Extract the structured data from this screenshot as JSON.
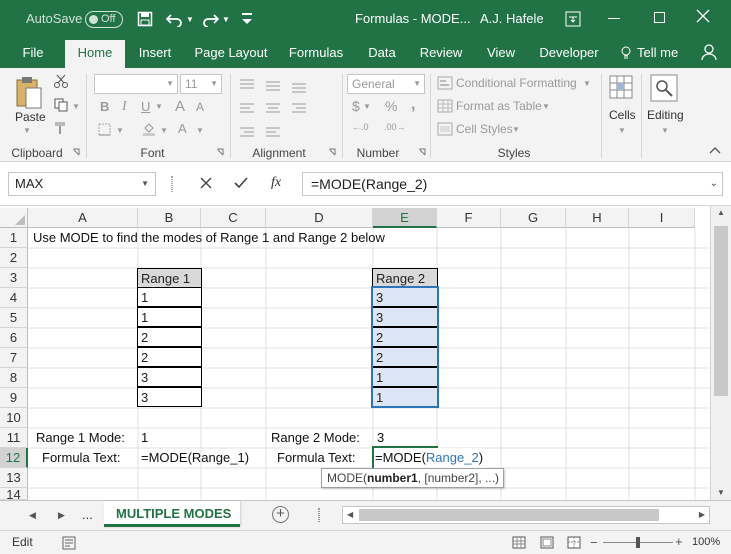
{
  "titlebar": {
    "autosave_label": "AutoSave",
    "autosave_state": "Off",
    "doc_title": "Formulas - MODE...",
    "user": "A.J. Hafele"
  },
  "tabs": [
    "File",
    "Home",
    "Insert",
    "Page Layout",
    "Formulas",
    "Data",
    "Review",
    "View",
    "Developer"
  ],
  "active_tab": "Home",
  "tell_me": "Tell me",
  "ribbon": {
    "paste": "Paste",
    "clipboard": "Clipboard",
    "font": "Font",
    "font_size": "11",
    "alignment": "Alignment",
    "number_format": "General",
    "number": "Number",
    "conditional_formatting": "Conditional Formatting",
    "format_as_table": "Format as Table",
    "cell_styles": "Cell Styles",
    "styles": "Styles",
    "cells": "Cells",
    "editing": "Editing"
  },
  "formula_bar": {
    "name_box": "MAX",
    "formula": "=MODE(Range_2)"
  },
  "columns": [
    "A",
    "B",
    "C",
    "D",
    "E",
    "F",
    "G",
    "H",
    "I"
  ],
  "selected_column": "E",
  "rows": [
    "1",
    "2",
    "3",
    "4",
    "5",
    "6",
    "7",
    "8",
    "9",
    "10",
    "11",
    "12",
    "13",
    "14"
  ],
  "selected_row": "12",
  "sheet": {
    "a1": "Use MODE to find the modes of Range 1 and Range 2 below",
    "range1_header": "Range 1",
    "range1_values": [
      "1",
      "1",
      "2",
      "2",
      "3",
      "3"
    ],
    "range2_header": "Range 2",
    "range2_values": [
      "3",
      "3",
      "2",
      "2",
      "1",
      "1"
    ],
    "range1_mode_label": "Range 1 Mode:",
    "range1_mode_value": "1",
    "range2_mode_label": "Range 2 Mode:",
    "range2_mode_value": "3",
    "formula_text_label_1": "Formula Text:",
    "formula_text_1": "=MODE(Range_1)",
    "formula_text_label_2": "Formula Text:",
    "edit_prefix": "=MODE(",
    "edit_ref": "Range_2",
    "edit_suffix": ")",
    "tooltip_prefix": "MODE(",
    "tooltip_bold": "number1",
    "tooltip_suffix": ", [number2], ...)"
  },
  "sheet_tabs": {
    "ellipsis": "...",
    "active": "MULTIPLE MODES"
  },
  "status": {
    "mode": "Edit",
    "zoom": "100%"
  },
  "colors": {
    "excel_green": "#217346",
    "range_blue": "#2e75b6",
    "range_fill": "#dce6f5"
  }
}
